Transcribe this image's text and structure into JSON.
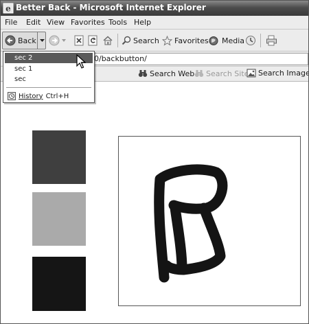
{
  "window": {
    "title": "Better Back - Microsoft Internet Explorer"
  },
  "menu": [
    "File",
    "Edit",
    "View",
    "Favorites",
    "Tools",
    "Help"
  ],
  "toolbar": {
    "back_label": "Back",
    "search_label": "Search",
    "favorites_label": "Favorites",
    "media_label": "Media"
  },
  "address": {
    "value": "8500/backbutton/"
  },
  "search_bar": {
    "search_web": "Search Web",
    "search_site": "Search Site",
    "search_images": "Search Images"
  },
  "history_menu": {
    "items": [
      "sec 2",
      "sec 1",
      "sec"
    ],
    "selected_index": 0,
    "history_label": "History",
    "history_shortcut": "Ctrl+H"
  },
  "content": {
    "swatches": [
      {
        "name": "dark-gray",
        "color": "#3f3f3f"
      },
      {
        "name": "light-gray",
        "color": "#aaaaaa"
      },
      {
        "name": "near-black",
        "color": "#151515"
      }
    ],
    "drawing_letter": "B"
  }
}
